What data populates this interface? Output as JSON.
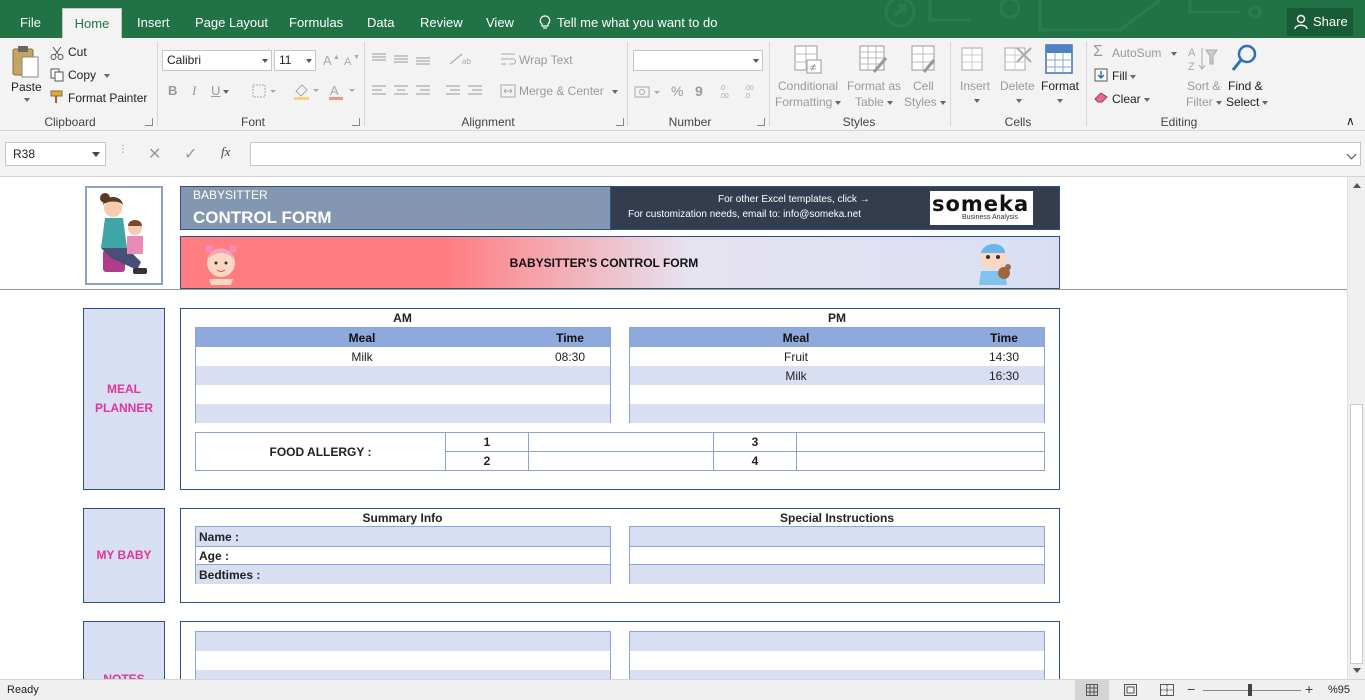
{
  "tabs": {
    "file": "File",
    "home": "Home",
    "insert": "Insert",
    "page_layout": "Page Layout",
    "formulas": "Formulas",
    "data": "Data",
    "review": "Review",
    "view": "View",
    "tell_me": "Tell me what you want to do",
    "share": "Share"
  },
  "ribbon": {
    "clipboard": {
      "paste": "Paste",
      "cut": "Cut",
      "copy": "Copy",
      "format_painter": "Format Painter",
      "label": "Clipboard"
    },
    "font": {
      "name": "Calibri",
      "size": "11",
      "label": "Font"
    },
    "alignment": {
      "wrap_text": "Wrap Text",
      "merge_center": "Merge & Center",
      "label": "Alignment"
    },
    "number": {
      "format": "",
      "label": "Number",
      "percent": "%",
      "comma": "9"
    },
    "styles": {
      "conditional": "Conditional",
      "formatting": "Formatting",
      "format_as": "Format as",
      "table": "Table",
      "cell": "Cell",
      "styles": "Styles",
      "label": "Styles"
    },
    "cells": {
      "insert": "Insert",
      "delete": "Delete",
      "format": "Format",
      "label": "Cells"
    },
    "editing": {
      "autosum": "AutoSum",
      "fill": "Fill",
      "clear": "Clear",
      "sort": "Sort &",
      "filter": "Filter",
      "find": "Find &",
      "select": "Select",
      "label": "Editing"
    }
  },
  "formula_bar": {
    "name_box": "R38",
    "fx": "fx",
    "value": ""
  },
  "form": {
    "header_small": "BABYSITTER",
    "header_big": "CONTROL FORM",
    "promo_line1": "For other Excel templates, click →",
    "promo_line2": "For customization needs, email to: info@someka.net",
    "logo_text": "someka",
    "logo_sub": "Business Analysis",
    "banner_title": "BABYSITTER'S CONTROL FORM",
    "meal_planner": {
      "label_line1": "MEAL",
      "label_line2": "PLANNER",
      "am": {
        "title": "AM",
        "col_meal": "Meal",
        "col_time": "Time",
        "rows": [
          {
            "meal": "Milk",
            "time": "08:30"
          },
          {
            "meal": "",
            "time": ""
          },
          {
            "meal": "",
            "time": ""
          },
          {
            "meal": "",
            "time": ""
          }
        ]
      },
      "pm": {
        "title": "PM",
        "col_meal": "Meal",
        "col_time": "Time",
        "rows": [
          {
            "meal": "Fruit",
            "time": "14:30"
          },
          {
            "meal": "Milk",
            "time": "16:30"
          },
          {
            "meal": "",
            "time": ""
          },
          {
            "meal": "",
            "time": ""
          }
        ]
      },
      "food_allergy": {
        "label": "FOOD ALLERGY :",
        "n1": "1",
        "n2": "2",
        "n3": "3",
        "n4": "4",
        "v1": "",
        "v2": "",
        "v3": "",
        "v4": ""
      }
    },
    "my_baby": {
      "label": "MY BABY",
      "summary_title": "Summary Info",
      "name_label": "Name :",
      "age_label": "Age :",
      "bedtimes_label": "Bedtimes :",
      "special_title": "Special Instructions"
    },
    "notes": {
      "label": "NOTES"
    }
  },
  "status": {
    "ready": "Ready",
    "zoom": "%95"
  },
  "colors": {
    "excel_green": "#217346",
    "form_blue": "#2f4f87",
    "header_blue": "#8ea9db",
    "stripe": "#d9dff3",
    "pink_label": "#e0359a",
    "banner_pink": "#ff7c80"
  }
}
